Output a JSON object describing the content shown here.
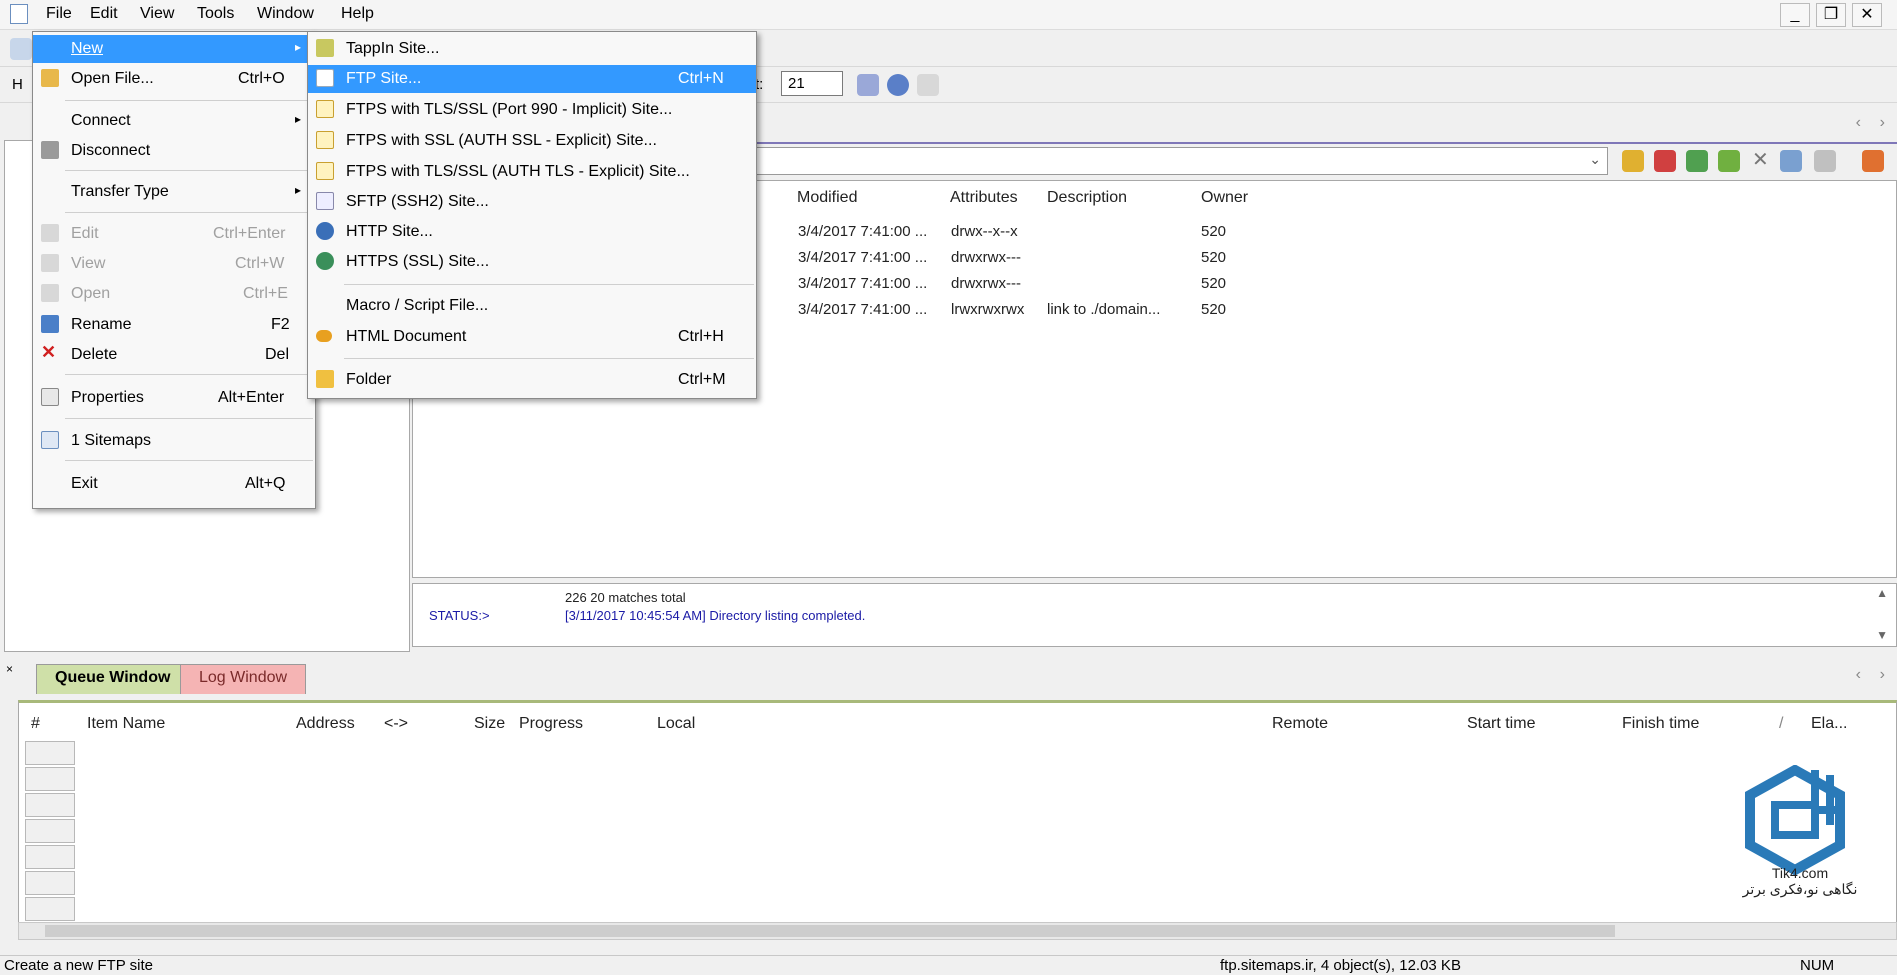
{
  "menubar": {
    "items": [
      {
        "label": "File"
      },
      {
        "label": "Edit"
      },
      {
        "label": "View"
      },
      {
        "label": "Tools"
      },
      {
        "label": "Window"
      },
      {
        "label": "Help"
      }
    ],
    "window_controls": [
      "_",
      "❐",
      "✕"
    ]
  },
  "toolbar": {
    "port_label": "rt:",
    "port_value": "21",
    "left_partial_label": "H"
  },
  "file_menu": {
    "items": [
      {
        "label": "New",
        "shortcut": "",
        "icon": "blank",
        "has_submenu": true,
        "highlighted": true,
        "disabled": false
      },
      {
        "label": "Open File...",
        "shortcut": "Ctrl+O",
        "icon": "folder-open-icon",
        "has_submenu": false,
        "highlighted": false,
        "disabled": false
      },
      {
        "label": "Connect",
        "shortcut": "",
        "icon": "blank",
        "has_submenu": true,
        "highlighted": false,
        "disabled": false
      },
      {
        "label": "Disconnect",
        "shortcut": "",
        "icon": "disconnect-icon",
        "has_submenu": false,
        "highlighted": false,
        "disabled": false
      },
      {
        "label": "Transfer Type",
        "shortcut": "",
        "icon": "blank",
        "has_submenu": true,
        "highlighted": false,
        "disabled": false
      },
      {
        "label": "Edit",
        "shortcut": "Ctrl+Enter",
        "icon": "edit-icon",
        "has_submenu": false,
        "highlighted": false,
        "disabled": true
      },
      {
        "label": "View",
        "shortcut": "Ctrl+W",
        "icon": "view-icon",
        "has_submenu": false,
        "highlighted": false,
        "disabled": true
      },
      {
        "label": "Open",
        "shortcut": "Ctrl+E",
        "icon": "open-icon",
        "has_submenu": false,
        "highlighted": false,
        "disabled": true
      },
      {
        "label": "Rename",
        "shortcut": "F2",
        "icon": "rename-icon",
        "has_submenu": false,
        "highlighted": false,
        "disabled": false
      },
      {
        "label": "Delete",
        "shortcut": "Del",
        "icon": "delete-icon",
        "has_submenu": false,
        "highlighted": false,
        "disabled": false
      },
      {
        "label": "Properties",
        "shortcut": "Alt+Enter",
        "icon": "properties-icon",
        "has_submenu": false,
        "highlighted": false,
        "disabled": false
      },
      {
        "label": "1 Sitemaps",
        "shortcut": "",
        "icon": "document-icon",
        "has_submenu": false,
        "highlighted": false,
        "disabled": false
      },
      {
        "label": "Exit",
        "shortcut": "Alt+Q",
        "icon": "blank",
        "has_submenu": false,
        "highlighted": false,
        "disabled": false
      }
    ]
  },
  "new_submenu": {
    "items": [
      {
        "label": "TappIn Site...",
        "shortcut": "",
        "icon": "tappin-icon",
        "highlighted": false
      },
      {
        "label": "FTP Site...",
        "shortcut": "Ctrl+N",
        "icon": "ftp-page-icon",
        "highlighted": true
      },
      {
        "label": "FTPS with TLS/SSL (Port 990 - Implicit) Site...",
        "shortcut": "",
        "icon": "ftps-lock-icon",
        "highlighted": false
      },
      {
        "label": "FTPS with SSL (AUTH SSL - Explicit) Site...",
        "shortcut": "",
        "icon": "ftps-lock-icon",
        "highlighted": false
      },
      {
        "label": "FTPS with TLS/SSL (AUTH TLS - Explicit) Site...",
        "shortcut": "",
        "icon": "ftps-lock-icon",
        "highlighted": false
      },
      {
        "label": "SFTP (SSH2) Site...",
        "shortcut": "",
        "icon": "sftp-icon",
        "highlighted": false
      },
      {
        "label": "HTTP Site...",
        "shortcut": "",
        "icon": "http-globe-icon",
        "highlighted": false
      },
      {
        "label": "HTTPS (SSL) Site...",
        "shortcut": "",
        "icon": "https-globe-icon",
        "highlighted": false
      },
      {
        "label": "Macro / Script File...",
        "shortcut": "",
        "icon": "blank",
        "highlighted": false
      },
      {
        "label": "HTML Document",
        "shortcut": "Ctrl+H",
        "icon": "html-doc-icon",
        "highlighted": false
      },
      {
        "label": "Folder",
        "shortcut": "Ctrl+M",
        "icon": "folder-icon",
        "highlighted": false
      }
    ]
  },
  "file_list": {
    "columns": [
      "Modified",
      "Attributes",
      "Description",
      "Owner"
    ],
    "rows": [
      {
        "modified": "3/4/2017 7:41:00 ...",
        "attributes": "drwx--x--x",
        "description": "",
        "owner": "520"
      },
      {
        "modified": "3/4/2017 7:41:00 ...",
        "attributes": "drwxrwx---",
        "description": "",
        "owner": "520"
      },
      {
        "modified": "3/4/2017 7:41:00 ...",
        "attributes": "drwxrwx---",
        "description": "",
        "owner": "520"
      },
      {
        "modified": "3/4/2017 7:41:00 ...",
        "attributes": "lrwxrwxrwx",
        "description": "link to ./domain...",
        "owner": "520"
      }
    ]
  },
  "status_log": {
    "line1": "226 20 matches total",
    "label": "STATUS:>",
    "line2": "[3/11/2017 10:45:54 AM] Directory listing completed."
  },
  "queue": {
    "tabs": [
      {
        "label": "Queue Window",
        "color": "#cfe0a8"
      },
      {
        "label": "Log Window",
        "color": "#f5b4b4"
      }
    ],
    "columns": [
      "#",
      "Item Name",
      "Address",
      "<->",
      "Size",
      "Progress",
      "Local",
      "Remote",
      "Start time",
      "Finish time",
      "/",
      "Ela..."
    ]
  },
  "statusbar": {
    "left": "Create a new FTP site",
    "middle": "ftp.sitemaps.ir, 4 object(s), 12.03 KB",
    "right": "NUM"
  },
  "watermark": {
    "brand": "Tik4.com",
    "tagline": "نگاهی نو،فکری برتر"
  },
  "colors": {
    "menu_highlight": "#3399ff",
    "status_text": "#1a1aa6",
    "logo": "#2a7ab8"
  }
}
